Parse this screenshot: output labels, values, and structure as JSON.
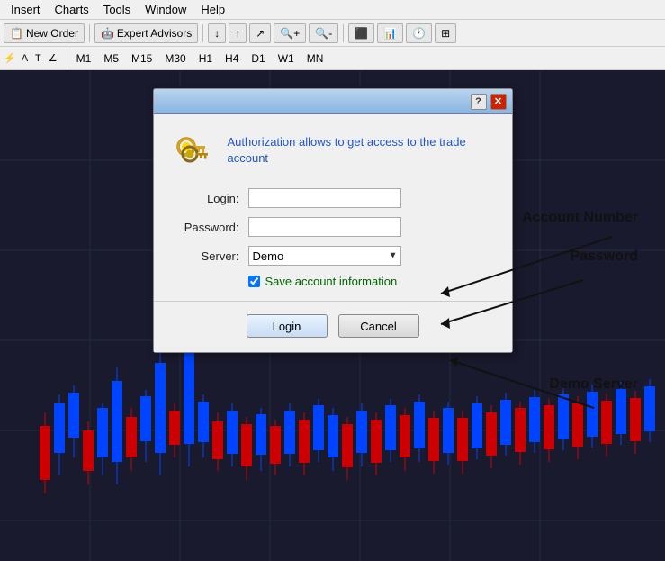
{
  "menubar": {
    "items": [
      "Insert",
      "Charts",
      "Tools",
      "Window",
      "Help"
    ]
  },
  "toolbar1": {
    "neworder_label": "New Order",
    "expertadvisors_label": "Expert Advisors"
  },
  "toolbar2": {
    "timeframes": [
      "M1",
      "M5",
      "M15",
      "M30",
      "H1",
      "H4",
      "D1",
      "W1",
      "MN"
    ]
  },
  "dialog": {
    "title": "",
    "help_btn": "?",
    "close_btn": "✕",
    "description": "Authorization allows to get access to the trade account",
    "login_label": "Login:",
    "login_value": "",
    "password_label": "Password:",
    "password_value": "",
    "server_label": "Server:",
    "server_value": "Demo",
    "save_label": "Save account information",
    "login_btn": "Login",
    "cancel_btn": "Cancel"
  },
  "annotations": {
    "account_number": "Account Number",
    "password": "Password",
    "demo_server": "Demo Server"
  }
}
